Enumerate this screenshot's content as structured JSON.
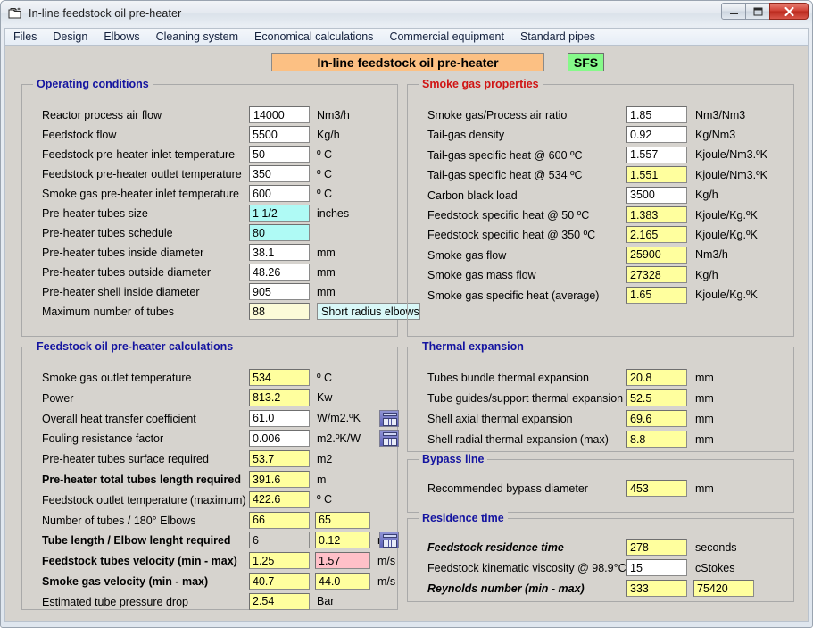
{
  "window": {
    "title": "In-line feedstock oil pre-heater",
    "icon": "window-document-icon",
    "buttons": {
      "minimize": "—",
      "maximize": "□",
      "close": "✕"
    }
  },
  "menubar": {
    "items": [
      "Files",
      "Design",
      "Elbows",
      "Cleaning system",
      "Economical calculations",
      "Commercial equipment",
      "Standard pipes"
    ]
  },
  "header": {
    "banner": "In-line feedstock oil pre-heater",
    "badge": "SFS"
  },
  "groups": {
    "operating_conditions": {
      "title": "Operating conditions",
      "rows": [
        {
          "label": "Reactor process air flow",
          "value": "14000",
          "unit": "Nm3/h",
          "style": "white",
          "focused": true
        },
        {
          "label": "Feedstock flow",
          "value": "5500",
          "unit": "Kg/h",
          "style": "white"
        },
        {
          "label": "Feedstock pre-heater inlet temperature",
          "value": "50",
          "unit": "º C",
          "style": "white"
        },
        {
          "label": "Feedstock pre-heater outlet temperature",
          "value": "350",
          "unit": "º C",
          "style": "white"
        },
        {
          "label": "Smoke gas pre-heater inlet temperature",
          "value": "600",
          "unit": "º C",
          "style": "white"
        },
        {
          "label": "Pre-heater tubes size",
          "value": "1 1/2",
          "unit": "inches",
          "style": "cyan"
        },
        {
          "label": "Pre-heater tubes schedule",
          "value": "80",
          "unit": "",
          "style": "cyan"
        },
        {
          "label": "Pre-heater tubes inside diameter",
          "value": "38.1",
          "unit": "mm",
          "style": "white"
        },
        {
          "label": "Pre-heater tubes outside diameter",
          "value": "48.26",
          "unit": "mm",
          "style": "white"
        },
        {
          "label": "Pre-heater shell inside diameter",
          "value": "905",
          "unit": "mm",
          "style": "white"
        },
        {
          "label": "Maximum number of tubes",
          "value": "88",
          "unit": "",
          "style": "pale",
          "extra_button": "Short radius elbows"
        }
      ]
    },
    "preheater_calculations": {
      "title": "Feedstock oil pre-heater calculations",
      "rows": [
        {
          "label": "Smoke gas outlet temperature",
          "value": "534",
          "unit": "º C",
          "style": "yellow"
        },
        {
          "label": "Power",
          "value": "813.2",
          "unit": "Kw",
          "style": "yellow"
        },
        {
          "label": "Overall heat transfer coefficient",
          "value": "61.0",
          "unit": "W/m2.ºK",
          "style": "white",
          "calc": true
        },
        {
          "label": "Fouling resistance factor",
          "value": "0.006",
          "unit": "m2.ºK/W",
          "style": "white",
          "calc": true
        },
        {
          "label": "Pre-heater tubes surface required",
          "value": "53.7",
          "unit": "m2",
          "style": "yellow"
        },
        {
          "label": "Pre-heater total tubes length required",
          "value": "391.6",
          "unit": "m",
          "style": "yellow",
          "bold": true
        },
        {
          "label": "Feedstock outlet temperature (maximum)",
          "value": "422.6",
          "unit": "º C",
          "style": "yellow"
        },
        {
          "label": "Number of tubes / 180° Elbows",
          "value": "66",
          "value2": "65",
          "unit": "",
          "style": "yellow",
          "style2": "yellow"
        },
        {
          "label": "Tube length / Elbow lenght required",
          "value": "6",
          "value2": "0.12",
          "unit": "m",
          "style": "grey",
          "style2": "yellow",
          "bold": true,
          "calc": true
        },
        {
          "label": "Feedstock tubes velocity (min - max)",
          "value": "1.25",
          "value2": "1.57",
          "unit": "m/s",
          "style": "yellow",
          "style2": "pink",
          "bold": true
        },
        {
          "label": "Smoke gas velocity (min - max)",
          "value": "40.7",
          "value2": "44.0",
          "unit": "m/s",
          "style": "yellow",
          "style2": "yellow",
          "bold": true
        },
        {
          "label": "Estimated tube pressure drop",
          "value": "2.54",
          "unit": "Bar",
          "style": "yellow"
        }
      ]
    },
    "smoke_gas_properties": {
      "title": "Smoke gas properties",
      "rows": [
        {
          "label": "Smoke gas/Process air ratio",
          "value": "1.85",
          "unit": "Nm3/Nm3",
          "style": "white"
        },
        {
          "label": "Tail-gas density",
          "value": "0.92",
          "unit": "Kg/Nm3",
          "style": "white"
        },
        {
          "label": "Tail-gas specific heat @ 600 ºC",
          "value": "1.557",
          "unit": "Kjoule/Nm3.ºK",
          "style": "white"
        },
        {
          "label": "Tail-gas specific heat @ 534 ºC",
          "value": "1.551",
          "unit": "Kjoule/Nm3.ºK",
          "style": "yellow"
        },
        {
          "label": "Carbon black load",
          "value": "3500",
          "unit": "Kg/h",
          "style": "white"
        },
        {
          "label": "Feedstock specific heat @ 50 ºC",
          "value": "1.383",
          "unit": "Kjoule/Kg.ºK",
          "style": "yellow"
        },
        {
          "label": "Feedstock specific heat @ 350 ºC",
          "value": "2.165",
          "unit": "Kjoule/Kg.ºK",
          "style": "yellow"
        },
        {
          "label": "Smoke gas flow",
          "value": "25900",
          "unit": "Nm3/h",
          "style": "yellow"
        },
        {
          "label": "Smoke gas mass flow",
          "value": "27328",
          "unit": "Kg/h",
          "style": "yellow"
        },
        {
          "label": "Smoke gas specific heat (average)",
          "value": "1.65",
          "unit": "Kjoule/Kg.ºK",
          "style": "yellow"
        }
      ]
    },
    "thermal_expansion": {
      "title": "Thermal expansion",
      "rows": [
        {
          "label": "Tubes bundle thermal expansion",
          "value": "20.8",
          "unit": "mm",
          "style": "yellow"
        },
        {
          "label": "Tube guides/support thermal expansion",
          "value": "52.5",
          "unit": "mm",
          "style": "yellow"
        },
        {
          "label": "Shell axial thermal expansion",
          "value": "69.6",
          "unit": "mm",
          "style": "yellow"
        },
        {
          "label": "Shell radial thermal expansion (max)",
          "value": "8.8",
          "unit": "mm",
          "style": "yellow"
        }
      ]
    },
    "bypass_line": {
      "title": "Bypass line",
      "rows": [
        {
          "label": "Recommended bypass diameter",
          "value": "453",
          "unit": "mm",
          "style": "yellow"
        }
      ]
    },
    "residence_time": {
      "title": "Residence time",
      "rows": [
        {
          "label": "Feedstock residence time",
          "value": "278",
          "unit": "seconds",
          "style": "yellow",
          "italic": true
        },
        {
          "label": "Feedstock kinematic viscosity @ 98.9°C",
          "value": "15",
          "unit": "cStokes",
          "style": "white"
        },
        {
          "label": "Reynolds number (min - max)",
          "value": "333",
          "value2": "75420",
          "unit": "",
          "style": "yellow",
          "style2": "yellow",
          "italic": true
        }
      ]
    }
  },
  "colors": {
    "banner_bg": "#fcc083",
    "badge_bg": "#86f98a",
    "field_yellow": "#ffff9e",
    "field_cyan": "#affaf5",
    "field_pink": "#ffc0c8",
    "group_title_blue": "#1414a0",
    "group_title_red": "#d01414",
    "client_bg": "#d6d3ce"
  }
}
